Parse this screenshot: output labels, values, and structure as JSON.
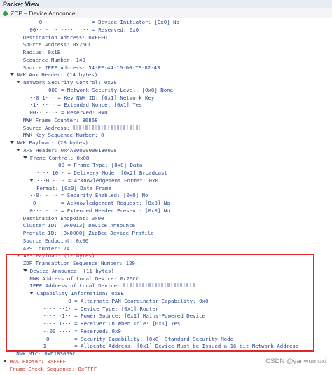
{
  "panel": {
    "title": "Packet View",
    "tab_label": "ZDP – Device Announce"
  },
  "rows": [
    {
      "indent": 8,
      "toggle": false,
      "text": "···0 ···· ···· ···· = Device Initiator: [0x0] No",
      "color": "blue"
    },
    {
      "indent": 8,
      "toggle": false,
      "text": "00·· ···· ···· ···· = Reserved: 0x0",
      "color": "blue"
    },
    {
      "indent": 6,
      "toggle": false,
      "text": "Destination Address: 0xFFFD",
      "color": "blue"
    },
    {
      "indent": 6,
      "toggle": false,
      "text": "Source Address: 0x26CC",
      "color": "blue"
    },
    {
      "indent": 6,
      "toggle": false,
      "text": "Radius: 0x1E",
      "color": "blue"
    },
    {
      "indent": 6,
      "toggle": false,
      "text": "Sequence Number: 149",
      "color": "blue"
    },
    {
      "indent": 6,
      "toggle": false,
      "text": "Source IEEE Address: 54:EF:44:10:00:7F:82:43",
      "color": "blue"
    },
    {
      "indent": 2,
      "toggle": true,
      "text": "NWK Aux Header: (14 bytes)",
      "color": "blue"
    },
    {
      "indent": 4,
      "toggle": true,
      "text": "Network Security Control: 0x28",
      "color": "blue"
    },
    {
      "indent": 8,
      "toggle": false,
      "text": "···· ·000 = Network Security Level: [0x0] None",
      "color": "blue"
    },
    {
      "indent": 8,
      "toggle": false,
      "text": "··0 1··· = Key NWK ID: [0x1] Network Key",
      "color": "blue"
    },
    {
      "indent": 8,
      "toggle": false,
      "text": "·1· ···· = Extended Nonce: [0x1] Yes",
      "color": "blue"
    },
    {
      "indent": 8,
      "toggle": false,
      "text": "00·· ···· = Reserved: 0x0",
      "color": "blue"
    },
    {
      "indent": 6,
      "toggle": false,
      "text": "NWK Frame Counter: 36868",
      "color": "blue"
    },
    {
      "indent": 6,
      "toggle": false,
      "text": "Source Address: ",
      "blur": 96,
      "color": "blue"
    },
    {
      "indent": 6,
      "toggle": false,
      "text": "NWK Key Sequence Number: 0",
      "color": "blue"
    },
    {
      "indent": 2,
      "toggle": true,
      "text": "NWK Payload: (20 bytes)",
      "color": "blue"
    },
    {
      "indent": 4,
      "toggle": true,
      "text": "APS Header: 0x4A00000000130008",
      "color": "blue"
    },
    {
      "indent": 6,
      "toggle": true,
      "text": "Frame Control: 0x08",
      "color": "blue"
    },
    {
      "indent": 10,
      "toggle": false,
      "text": "···· ··00 = Frame Type: [0x0] Data",
      "color": "blue"
    },
    {
      "indent": 10,
      "toggle": false,
      "text": "···· 10·· = Delivery Mode: [0x2] Broadcast",
      "color": "blue"
    },
    {
      "indent": 8,
      "toggle": true,
      "text": "···0 ···· = Acknowledgement Format: 0x0",
      "color": "blue"
    },
    {
      "indent": 10,
      "toggle": false,
      "text": "Format: [0x0] Data Frame",
      "color": "blue"
    },
    {
      "indent": 8,
      "toggle": false,
      "text": "··0· ···· = Security Enabled: [0x0] No",
      "color": "blue"
    },
    {
      "indent": 8,
      "toggle": false,
      "text": "·0·· ···· = Acknowledgement Request: [0x0] No",
      "color": "blue"
    },
    {
      "indent": 8,
      "toggle": false,
      "text": "0··· ···· = Extended Header Present: [0x0] No",
      "color": "blue"
    },
    {
      "indent": 6,
      "toggle": false,
      "text": "Destination Endpoint: 0x00",
      "color": "blue"
    },
    {
      "indent": 6,
      "toggle": false,
      "text": "Cluster ID: [0x0013] Device Announce",
      "color": "blue"
    },
    {
      "indent": 6,
      "toggle": false,
      "text": "Profile ID: [0x0000] ZigBee Device Profile",
      "color": "blue"
    },
    {
      "indent": 6,
      "toggle": false,
      "text": "Source Endpoint: 0x00",
      "color": "blue"
    },
    {
      "indent": 6,
      "toggle": false,
      "text": "APS Counter: 74",
      "color": "blue"
    },
    {
      "indent": 4,
      "toggle": true,
      "text": "APS Payload: (12 bytes)",
      "color": "blue"
    },
    {
      "indent": 6,
      "toggle": false,
      "text": "ZDP Transaction Sequence Number: 129",
      "color": "blue"
    },
    {
      "indent": 6,
      "toggle": true,
      "text": "Device Announce: (11 bytes)",
      "color": "blue"
    },
    {
      "indent": 8,
      "toggle": false,
      "text": "NWK Address of Local Device: 0x26CC",
      "color": "blue"
    },
    {
      "indent": 8,
      "toggle": false,
      "text": "IEEE Address of Local Device: ",
      "blur": 104,
      "color": "blue"
    },
    {
      "indent": 8,
      "toggle": true,
      "text": "Capability Information: 0x8E",
      "color": "blue"
    },
    {
      "indent": 12,
      "toggle": false,
      "text": "···· ···0 = Alternate PAN Coordinator Capability: 0x0",
      "color": "blue"
    },
    {
      "indent": 12,
      "toggle": false,
      "text": "···· ··1· = Device Type: [0x1] Router",
      "color": "blue"
    },
    {
      "indent": 12,
      "toggle": false,
      "text": "···· ·1·· = Power Source: [0x1] Mains-Powered Device",
      "color": "blue"
    },
    {
      "indent": 12,
      "toggle": false,
      "text": "···· 1··· = Receiver On When Idle: [0x1] Yes",
      "color": "blue"
    },
    {
      "indent": 12,
      "toggle": false,
      "text": "··00 ···· = Reserved: 0x0",
      "color": "blue"
    },
    {
      "indent": 12,
      "toggle": false,
      "text": "·0·· ···· = Security Capability: [0x0] Standard Security Mode",
      "color": "blue"
    },
    {
      "indent": 12,
      "toggle": false,
      "text": "1··· ···· = Allocate Address: [0x1] Device Must be Issued a 16-bit Network Address",
      "color": "blue"
    },
    {
      "indent": 4,
      "toggle": false,
      "text": "NWK MIC: 0xD183069C",
      "color": "blue"
    },
    {
      "indent": 0,
      "toggle": true,
      "text": "MAC Footer: 0xFFFF",
      "color": "red"
    },
    {
      "indent": 2,
      "toggle": false,
      "text": "Frame Check Sequence: 0xFFFF",
      "color": "red"
    }
  ],
  "watermark": "CSDN @yanwumuxi"
}
